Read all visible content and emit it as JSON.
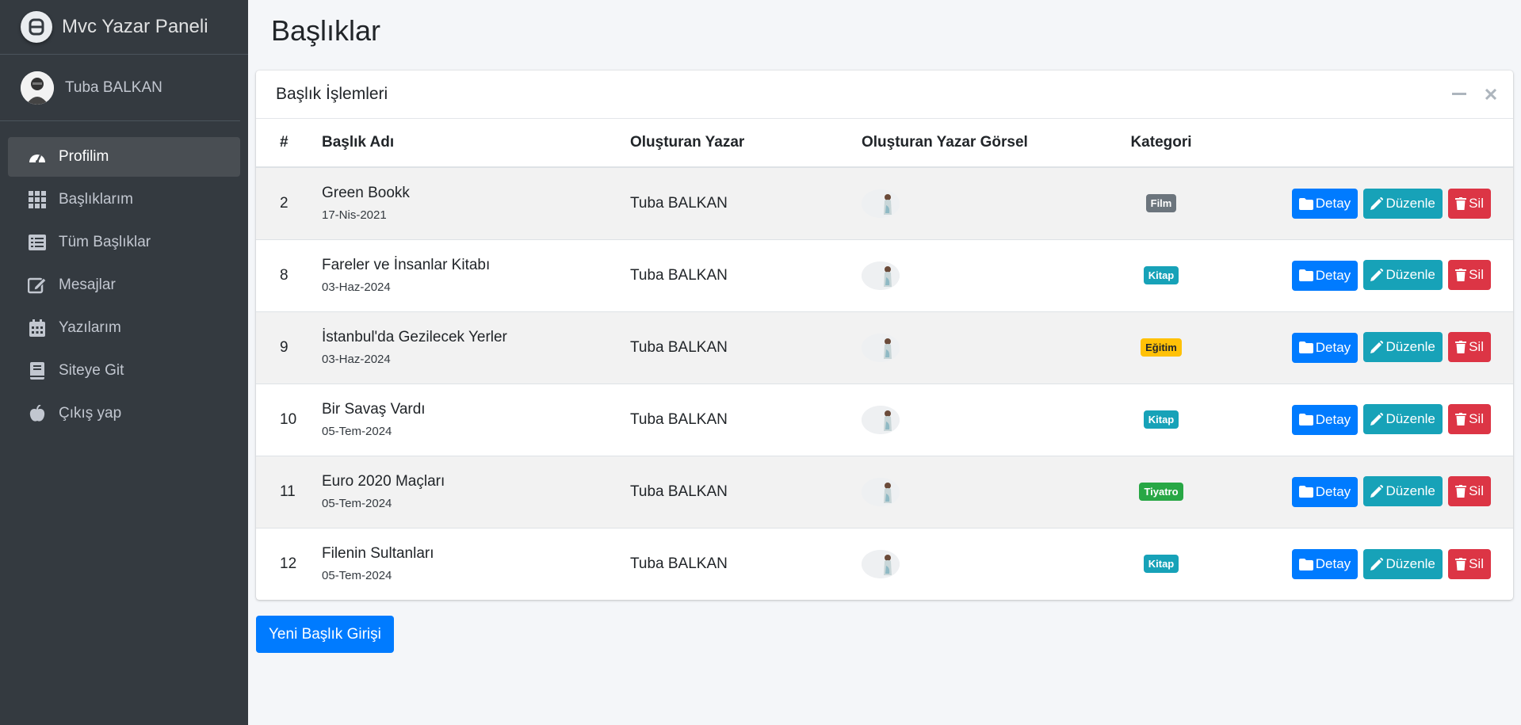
{
  "brand": {
    "title": "Mvc Yazar Paneli"
  },
  "user": {
    "name": "Tuba BALKAN"
  },
  "nav": [
    {
      "label": "Profilim",
      "icon": "tachometer-icon",
      "active": true
    },
    {
      "label": "Başlıklarım",
      "icon": "grid-icon"
    },
    {
      "label": "Tüm Başlıklar",
      "icon": "list-icon"
    },
    {
      "label": "Mesajlar",
      "icon": "edit-icon"
    },
    {
      "label": "Yazılarım",
      "icon": "calendar-icon"
    },
    {
      "label": "Siteye Git",
      "icon": "book-icon"
    },
    {
      "label": "Çıkış yap",
      "icon": "apple-icon"
    }
  ],
  "page": {
    "title": "Başlıklar"
  },
  "card": {
    "title": "Başlık İşlemleri"
  },
  "table": {
    "headers": [
      "#",
      "Başlık Adı",
      "Oluşturan Yazar",
      "Oluşturan Yazar Görsel",
      "Kategori"
    ],
    "rows": [
      {
        "id": "2",
        "title": "Green Bookk",
        "date": "17-Nis-2021",
        "author": "Tuba BALKAN",
        "category": "Film",
        "category_color": "#6c757d"
      },
      {
        "id": "8",
        "title": "Fareler ve İnsanlar Kitabı",
        "date": "03-Haz-2024",
        "author": "Tuba BALKAN",
        "category": "Kitap",
        "category_color": "#17a2b8"
      },
      {
        "id": "9",
        "title": "İstanbul'da Gezilecek Yerler",
        "date": "03-Haz-2024",
        "author": "Tuba BALKAN",
        "category": "Eğitim",
        "category_color": "#ffc107"
      },
      {
        "id": "10",
        "title": "Bir Savaş Vardı",
        "date": "05-Tem-2024",
        "author": "Tuba BALKAN",
        "category": "Kitap",
        "category_color": "#17a2b8"
      },
      {
        "id": "11",
        "title": "Euro 2020 Maçları",
        "date": "05-Tem-2024",
        "author": "Tuba BALKAN",
        "category": "Tiyatro",
        "category_color": "#28a745"
      },
      {
        "id": "12",
        "title": "Filenin Sultanları",
        "date": "05-Tem-2024",
        "author": "Tuba BALKAN",
        "category": "Kitap",
        "category_color": "#17a2b8"
      }
    ]
  },
  "actions": {
    "detail": "Detay",
    "edit": "Düzenle",
    "delete": "Sil"
  },
  "new_button": "Yeni Başlık Girişi"
}
